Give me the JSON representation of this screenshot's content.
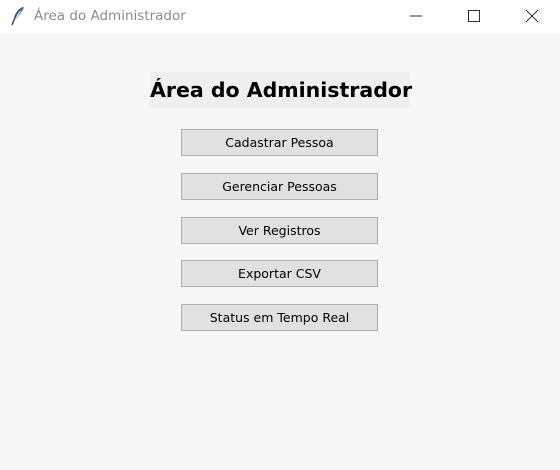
{
  "window": {
    "title": "Área do Administrador",
    "icon": "feather-icon",
    "controls": [
      "minimize-icon",
      "maximize-icon",
      "close-icon"
    ]
  },
  "main": {
    "heading": "Área do Administrador",
    "buttons": [
      {
        "label": "Cadastrar Pessoa"
      },
      {
        "label": "Gerenciar Pessoas"
      },
      {
        "label": "Ver Registros"
      },
      {
        "label": "Exportar CSV"
      },
      {
        "label": "Status em Tempo Real"
      }
    ]
  },
  "colors": {
    "background": "#f7f7f7",
    "titlebar": "#ffffff",
    "button_face": "#e1e1e1",
    "button_border": "#adadad"
  }
}
